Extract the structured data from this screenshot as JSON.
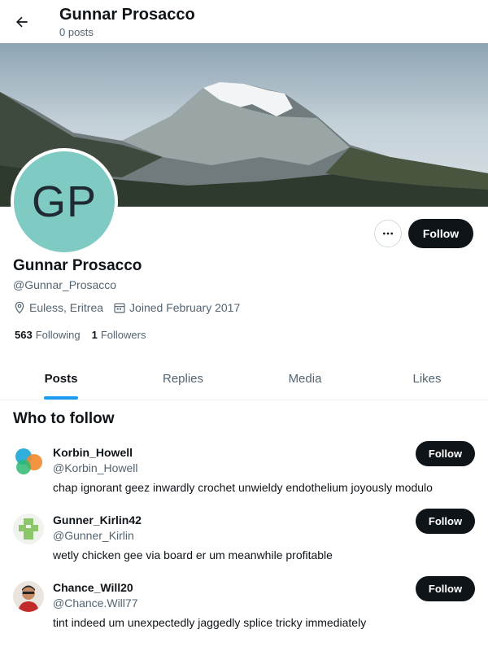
{
  "header": {
    "name": "Gunnar Prosacco",
    "posts": "0 posts"
  },
  "profile": {
    "initials": "GP",
    "name": "Gunnar Prosacco",
    "handle": "@Gunnar_Prosacco",
    "location": "Euless, Eritrea",
    "joined": "Joined February 2017",
    "following_count": "563",
    "following_label": "Following",
    "followers_count": "1",
    "followers_label": "Followers",
    "follow_label": "Follow",
    "avatar_color": "#7fcbc4"
  },
  "tabs": [
    {
      "label": "Posts",
      "active": true
    },
    {
      "label": "Replies",
      "active": false
    },
    {
      "label": "Media",
      "active": false
    },
    {
      "label": "Likes",
      "active": false
    }
  ],
  "who_to_follow": {
    "title": "Who to follow",
    "items": [
      {
        "name": "Korbin_Howell",
        "handle": "@Korbin_Howell",
        "bio": "chap ignorant geez inwardly crochet unwieldy endothelium joyously modulo",
        "follow_label": "Follow"
      },
      {
        "name": "Gunner_Kirlin42",
        "handle": "@Gunner_Kirlin",
        "bio": "wetly chicken gee via board er um meanwhile profitable",
        "follow_label": "Follow"
      },
      {
        "name": "Chance_Will20",
        "handle": "@Chance.Will77",
        "bio": "tint indeed um unexpectedly jaggedly splice tricky immediately",
        "follow_label": "Follow"
      }
    ]
  },
  "colors": {
    "accent": "#1d9bf0",
    "button": "#0f1419",
    "muted": "#536471"
  }
}
